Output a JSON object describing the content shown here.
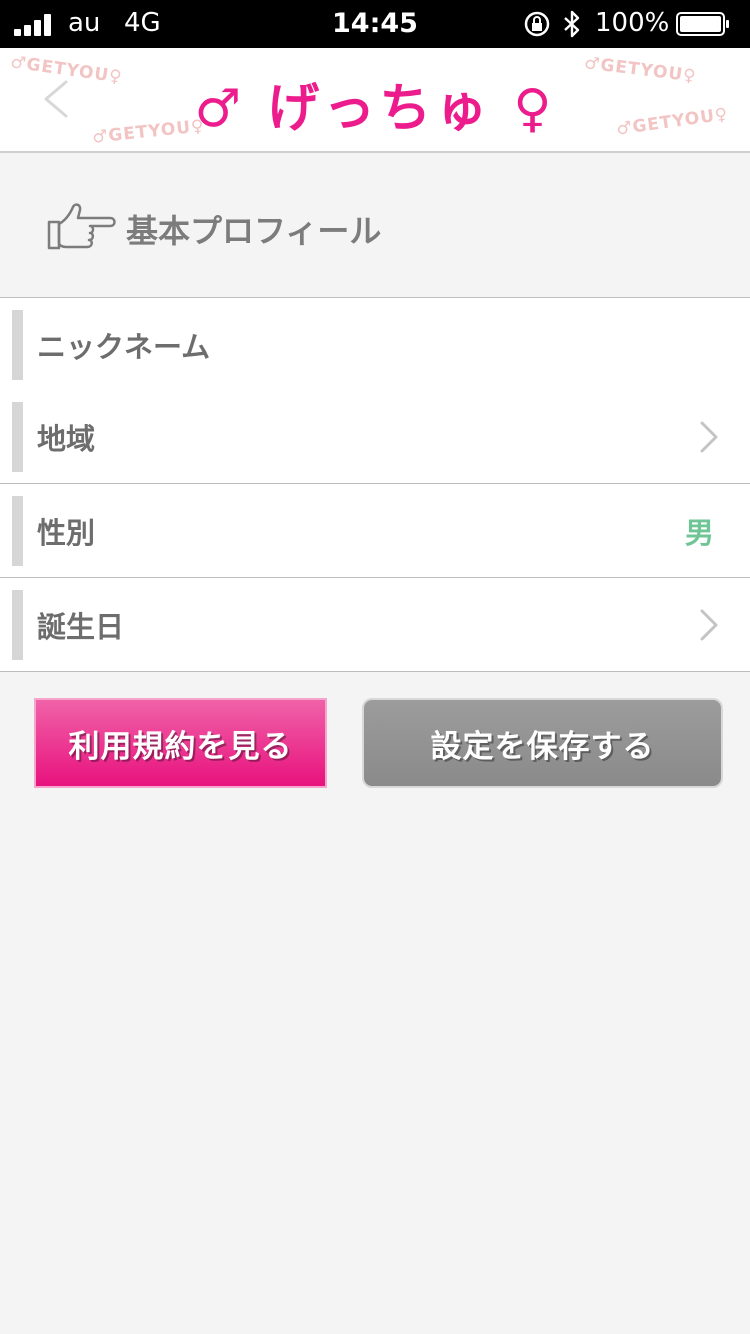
{
  "status_bar": {
    "carrier": "au",
    "network": "4G",
    "time": "14:45",
    "battery_percent": "100%",
    "battery_level": 1.0
  },
  "header": {
    "logo_text": "♂ げっちゅ ♀",
    "watermark_text": "♂GETYOU♀",
    "icons": [
      "back-arrow-icon"
    ]
  },
  "section": {
    "title": "基本プロフィール",
    "icon": "pointing-hand-icon"
  },
  "profile_rows": [
    {
      "label": "ニックネーム",
      "value": "",
      "accessory": "none"
    },
    {
      "label": "地域",
      "value": "",
      "accessory": "chevron-right-icon"
    },
    {
      "label": "性別",
      "value": "男",
      "accessory": "value"
    },
    {
      "label": "誕生日",
      "value": "",
      "accessory": "chevron-right-icon"
    }
  ],
  "buttons": {
    "terms_label": "利用規約を見る",
    "save_label": "設定を保存する"
  },
  "colors": {
    "brand_pink": "#ec1c8c",
    "gender_value": "#6fc596",
    "save_button": "#8f8f8f",
    "background": "#f4f4f4"
  }
}
